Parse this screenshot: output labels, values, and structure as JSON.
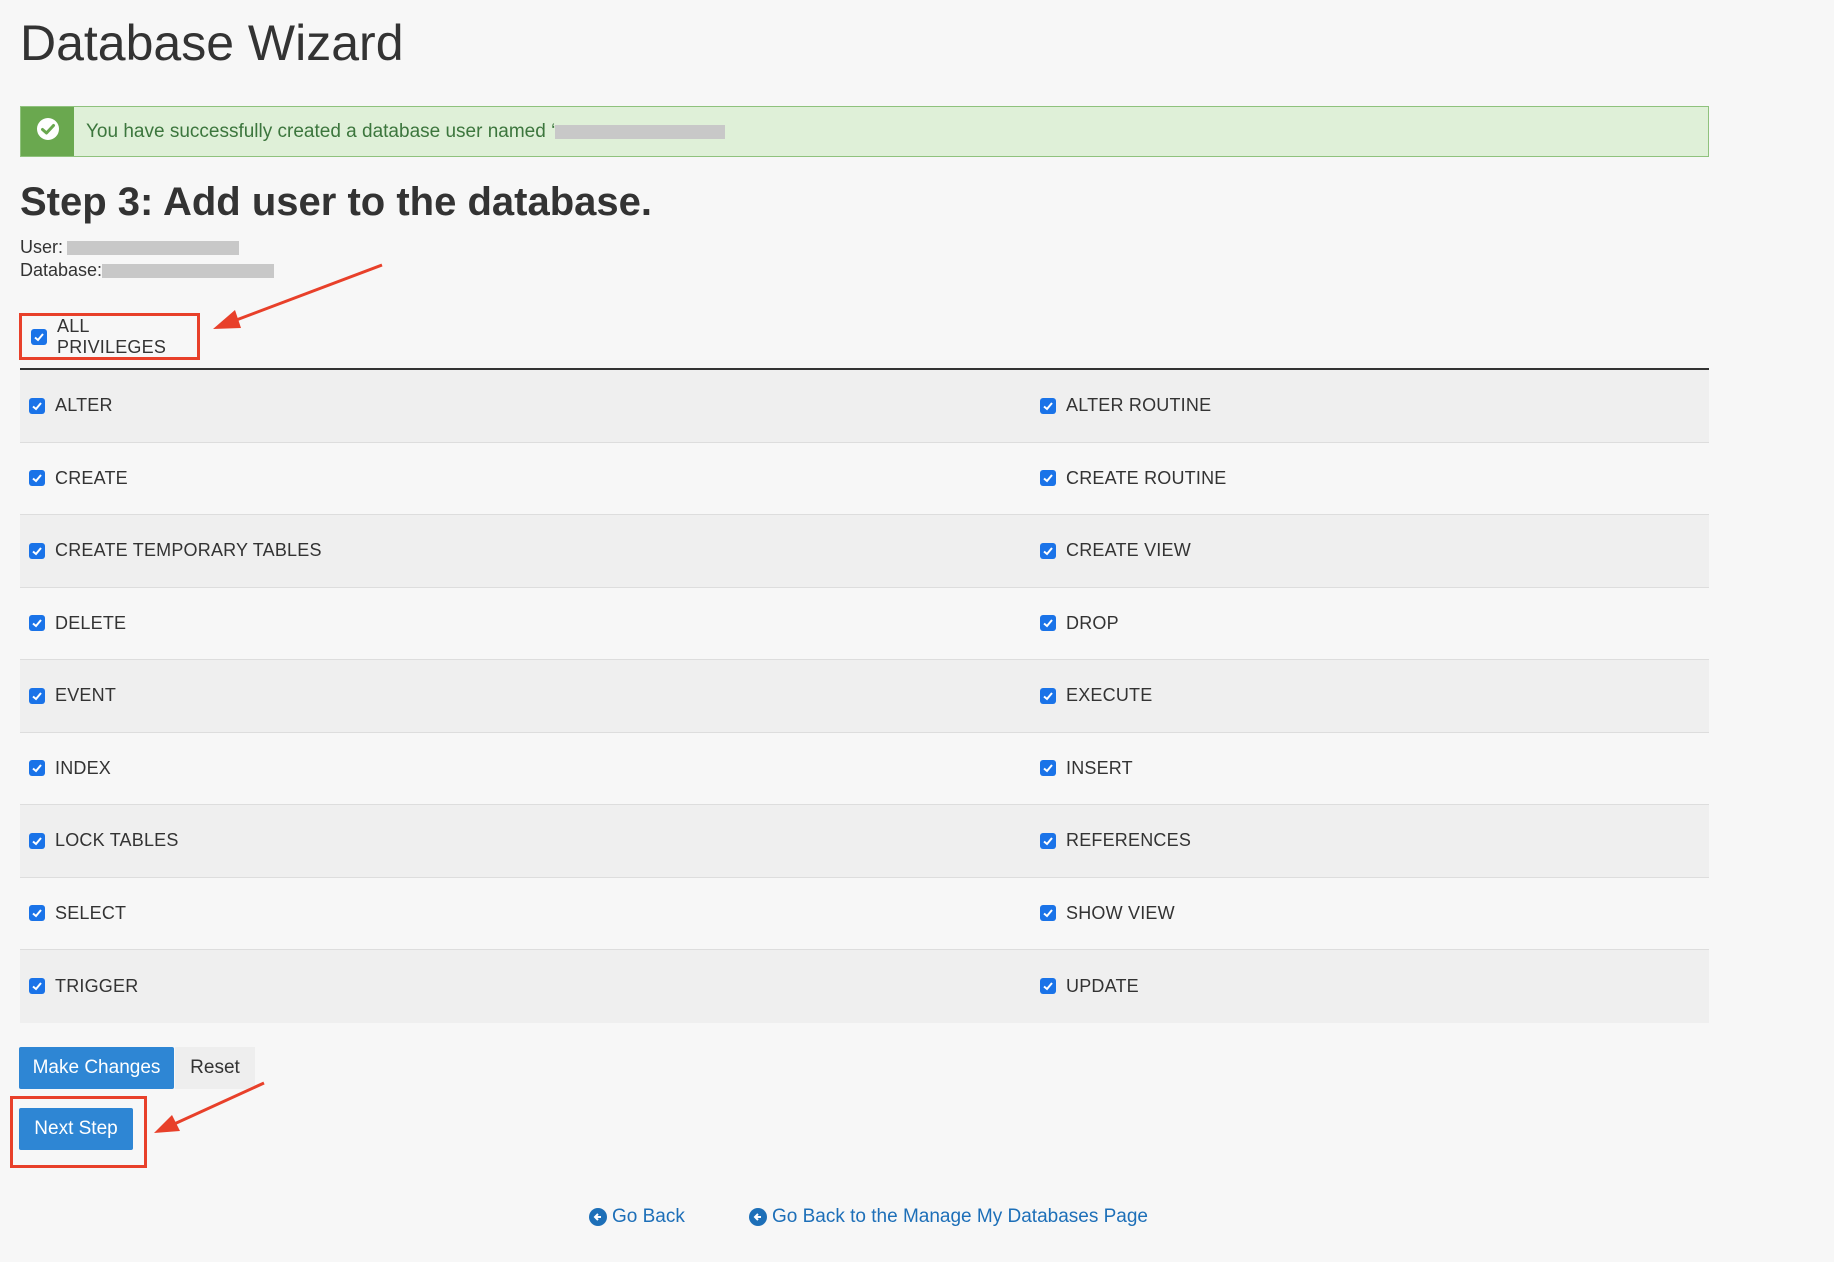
{
  "page_title": "Database Wizard",
  "alert": {
    "text": "You have successfully created a database user named ‘"
  },
  "step_heading": "Step 3: Add user to the database.",
  "meta": {
    "user_label": "User:",
    "database_label": "Database:"
  },
  "all_privileges": {
    "label": "ALL PRIVILEGES",
    "checked": true
  },
  "privileges": [
    {
      "left": "ALTER",
      "right": "ALTER ROUTINE"
    },
    {
      "left": "CREATE",
      "right": "CREATE ROUTINE"
    },
    {
      "left": "CREATE TEMPORARY TABLES",
      "right": "CREATE VIEW"
    },
    {
      "left": "DELETE",
      "right": "DROP"
    },
    {
      "left": "EVENT",
      "right": "EXECUTE"
    },
    {
      "left": "INDEX",
      "right": "INSERT"
    },
    {
      "left": "LOCK TABLES",
      "right": "REFERENCES"
    },
    {
      "left": "SELECT",
      "right": "SHOW VIEW"
    },
    {
      "left": "TRIGGER",
      "right": "UPDATE"
    }
  ],
  "buttons": {
    "make_changes": "Make Changes",
    "reset": "Reset",
    "next_step": "Next Step"
  },
  "footer": {
    "go_back": "Go Back",
    "go_back_manage": "Go Back to the Manage My Databases Page"
  },
  "colors": {
    "accent": "#2e86d4",
    "checkbox": "#1a73e8",
    "success_bg": "#dff0d8",
    "success_icon": "#6aa84f",
    "annotation": "#e8402a",
    "link": "#1d6fb8"
  }
}
